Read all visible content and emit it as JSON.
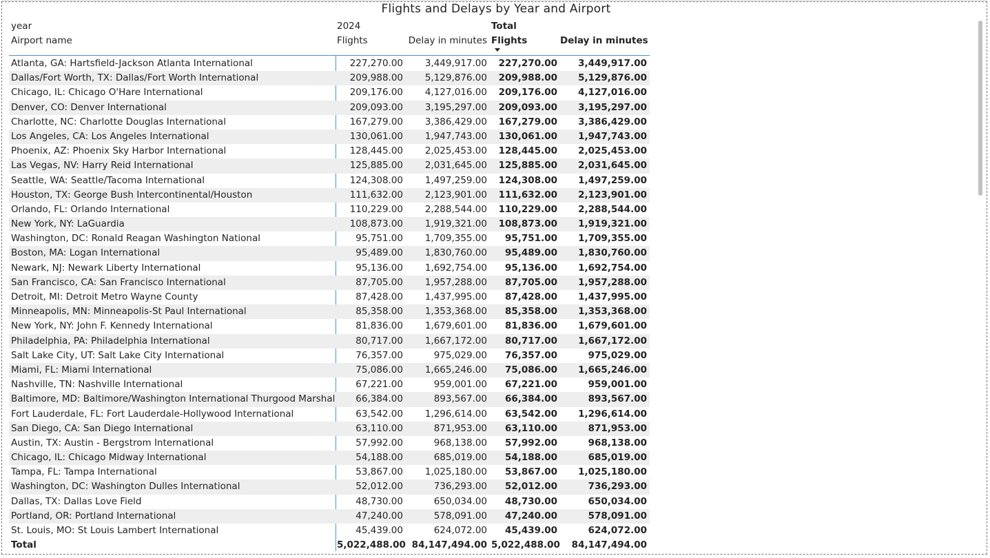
{
  "title": "Flights and Delays by Year and Airport",
  "header": {
    "row_label_1": "year",
    "row_label_2": "Airport name",
    "year_label": "2024",
    "flights_label": "Flights",
    "delay_label": "Delay in minutes",
    "total_label": "Total",
    "total_flights_label": "Flights",
    "total_delay_label": "Delay in minutes",
    "sort_indicator_icon": "sort-descending-icon"
  },
  "rows": [
    {
      "name": "Atlanta, GA: Hartsfield-Jackson Atlanta International",
      "flights": "227,270.00",
      "delay": "3,449,917.00",
      "total_flights": "227,270.00",
      "total_delay": "3,449,917.00"
    },
    {
      "name": "Dallas/Fort Worth, TX: Dallas/Fort Worth International",
      "flights": "209,988.00",
      "delay": "5,129,876.00",
      "total_flights": "209,988.00",
      "total_delay": "5,129,876.00"
    },
    {
      "name": "Chicago, IL: Chicago O'Hare International",
      "flights": "209,176.00",
      "delay": "4,127,016.00",
      "total_flights": "209,176.00",
      "total_delay": "4,127,016.00"
    },
    {
      "name": "Denver, CO: Denver International",
      "flights": "209,093.00",
      "delay": "3,195,297.00",
      "total_flights": "209,093.00",
      "total_delay": "3,195,297.00"
    },
    {
      "name": "Charlotte, NC: Charlotte Douglas International",
      "flights": "167,279.00",
      "delay": "3,386,429.00",
      "total_flights": "167,279.00",
      "total_delay": "3,386,429.00"
    },
    {
      "name": "Los Angeles, CA: Los Angeles International",
      "flights": "130,061.00",
      "delay": "1,947,743.00",
      "total_flights": "130,061.00",
      "total_delay": "1,947,743.00"
    },
    {
      "name": "Phoenix, AZ: Phoenix Sky Harbor International",
      "flights": "128,445.00",
      "delay": "2,025,453.00",
      "total_flights": "128,445.00",
      "total_delay": "2,025,453.00"
    },
    {
      "name": "Las Vegas, NV: Harry Reid International",
      "flights": "125,885.00",
      "delay": "2,031,645.00",
      "total_flights": "125,885.00",
      "total_delay": "2,031,645.00"
    },
    {
      "name": "Seattle, WA: Seattle/Tacoma International",
      "flights": "124,308.00",
      "delay": "1,497,259.00",
      "total_flights": "124,308.00",
      "total_delay": "1,497,259.00"
    },
    {
      "name": "Houston, TX: George Bush Intercontinental/Houston",
      "flights": "111,632.00",
      "delay": "2,123,901.00",
      "total_flights": "111,632.00",
      "total_delay": "2,123,901.00"
    },
    {
      "name": "Orlando, FL: Orlando International",
      "flights": "110,229.00",
      "delay": "2,288,544.00",
      "total_flights": "110,229.00",
      "total_delay": "2,288,544.00"
    },
    {
      "name": "New York, NY: LaGuardia",
      "flights": "108,873.00",
      "delay": "1,919,321.00",
      "total_flights": "108,873.00",
      "total_delay": "1,919,321.00"
    },
    {
      "name": "Washington, DC: Ronald Reagan Washington National",
      "flights": "95,751.00",
      "delay": "1,709,355.00",
      "total_flights": "95,751.00",
      "total_delay": "1,709,355.00"
    },
    {
      "name": "Boston, MA: Logan International",
      "flights": "95,489.00",
      "delay": "1,830,760.00",
      "total_flights": "95,489.00",
      "total_delay": "1,830,760.00"
    },
    {
      "name": "Newark, NJ: Newark Liberty International",
      "flights": "95,136.00",
      "delay": "1,692,754.00",
      "total_flights": "95,136.00",
      "total_delay": "1,692,754.00"
    },
    {
      "name": "San Francisco, CA: San Francisco International",
      "flights": "87,705.00",
      "delay": "1,957,288.00",
      "total_flights": "87,705.00",
      "total_delay": "1,957,288.00"
    },
    {
      "name": "Detroit, MI: Detroit Metro Wayne County",
      "flights": "87,428.00",
      "delay": "1,437,995.00",
      "total_flights": "87,428.00",
      "total_delay": "1,437,995.00"
    },
    {
      "name": "Minneapolis, MN: Minneapolis-St Paul International",
      "flights": "85,358.00",
      "delay": "1,353,368.00",
      "total_flights": "85,358.00",
      "total_delay": "1,353,368.00"
    },
    {
      "name": "New York, NY: John F. Kennedy International",
      "flights": "81,836.00",
      "delay": "1,679,601.00",
      "total_flights": "81,836.00",
      "total_delay": "1,679,601.00"
    },
    {
      "name": "Philadelphia, PA: Philadelphia International",
      "flights": "80,717.00",
      "delay": "1,667,172.00",
      "total_flights": "80,717.00",
      "total_delay": "1,667,172.00"
    },
    {
      "name": "Salt Lake City, UT: Salt Lake City International",
      "flights": "76,357.00",
      "delay": "975,029.00",
      "total_flights": "76,357.00",
      "total_delay": "975,029.00"
    },
    {
      "name": "Miami, FL: Miami International",
      "flights": "75,086.00",
      "delay": "1,665,246.00",
      "total_flights": "75,086.00",
      "total_delay": "1,665,246.00"
    },
    {
      "name": "Nashville, TN: Nashville International",
      "flights": "67,221.00",
      "delay": "959,001.00",
      "total_flights": "67,221.00",
      "total_delay": "959,001.00"
    },
    {
      "name": "Baltimore, MD: Baltimore/Washington International Thurgood Marshall",
      "flights": "66,384.00",
      "delay": "893,567.00",
      "total_flights": "66,384.00",
      "total_delay": "893,567.00"
    },
    {
      "name": "Fort Lauderdale, FL: Fort Lauderdale-Hollywood International",
      "flights": "63,542.00",
      "delay": "1,296,614.00",
      "total_flights": "63,542.00",
      "total_delay": "1,296,614.00"
    },
    {
      "name": "San Diego, CA: San Diego International",
      "flights": "63,110.00",
      "delay": "871,953.00",
      "total_flights": "63,110.00",
      "total_delay": "871,953.00"
    },
    {
      "name": "Austin, TX: Austin - Bergstrom International",
      "flights": "57,992.00",
      "delay": "968,138.00",
      "total_flights": "57,992.00",
      "total_delay": "968,138.00"
    },
    {
      "name": "Chicago, IL: Chicago Midway International",
      "flights": "54,188.00",
      "delay": "685,019.00",
      "total_flights": "54,188.00",
      "total_delay": "685,019.00"
    },
    {
      "name": "Tampa, FL: Tampa International",
      "flights": "53,867.00",
      "delay": "1,025,180.00",
      "total_flights": "53,867.00",
      "total_delay": "1,025,180.00"
    },
    {
      "name": "Washington, DC: Washington Dulles International",
      "flights": "52,012.00",
      "delay": "736,293.00",
      "total_flights": "52,012.00",
      "total_delay": "736,293.00"
    },
    {
      "name": "Dallas, TX: Dallas Love Field",
      "flights": "48,730.00",
      "delay": "650,034.00",
      "total_flights": "48,730.00",
      "total_delay": "650,034.00"
    },
    {
      "name": "Portland, OR: Portland International",
      "flights": "47,240.00",
      "delay": "578,091.00",
      "total_flights": "47,240.00",
      "total_delay": "578,091.00"
    },
    {
      "name": "St. Louis, MO: St Louis Lambert International",
      "flights": "45,439.00",
      "delay": "624,072.00",
      "total_flights": "45,439.00",
      "total_delay": "624,072.00"
    }
  ],
  "totals": {
    "label": "Total",
    "flights": "5,022,488.00",
    "delay": "84,147,494.00",
    "total_flights": "5,022,488.00",
    "total_delay": "84,147,494.00"
  },
  "colors": {
    "accent_line": "#4a90d9",
    "band": "#eeeeee",
    "text": "#252423"
  }
}
